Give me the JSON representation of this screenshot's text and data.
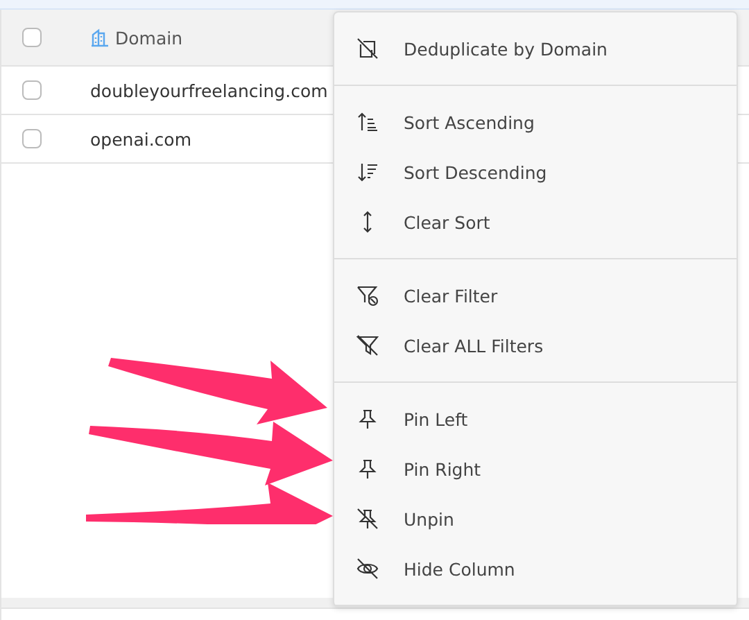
{
  "table": {
    "columns": [
      {
        "label": "Domain"
      }
    ],
    "rows": [
      {
        "checked": false,
        "domain": "doubleyourfreelancing.com"
      },
      {
        "checked": false,
        "domain": "openai.com"
      }
    ],
    "header_checked": false
  },
  "menu": {
    "sections": [
      [
        {
          "kind": "dedup",
          "label": "Deduplicate by Domain"
        }
      ],
      [
        {
          "kind": "sort-asc",
          "label": "Sort Ascending"
        },
        {
          "kind": "sort-desc",
          "label": "Sort Descending"
        },
        {
          "kind": "sort-clear",
          "label": "Clear Sort"
        }
      ],
      [
        {
          "kind": "filter-clear",
          "label": "Clear Filter"
        },
        {
          "kind": "filter-off",
          "label": "Clear ALL Filters"
        }
      ],
      [
        {
          "kind": "pin",
          "label": "Pin Left"
        },
        {
          "kind": "pin",
          "label": "Pin Right"
        },
        {
          "kind": "unpin",
          "label": "Unpin"
        },
        {
          "kind": "hide",
          "label": "Hide Column"
        }
      ]
    ]
  }
}
